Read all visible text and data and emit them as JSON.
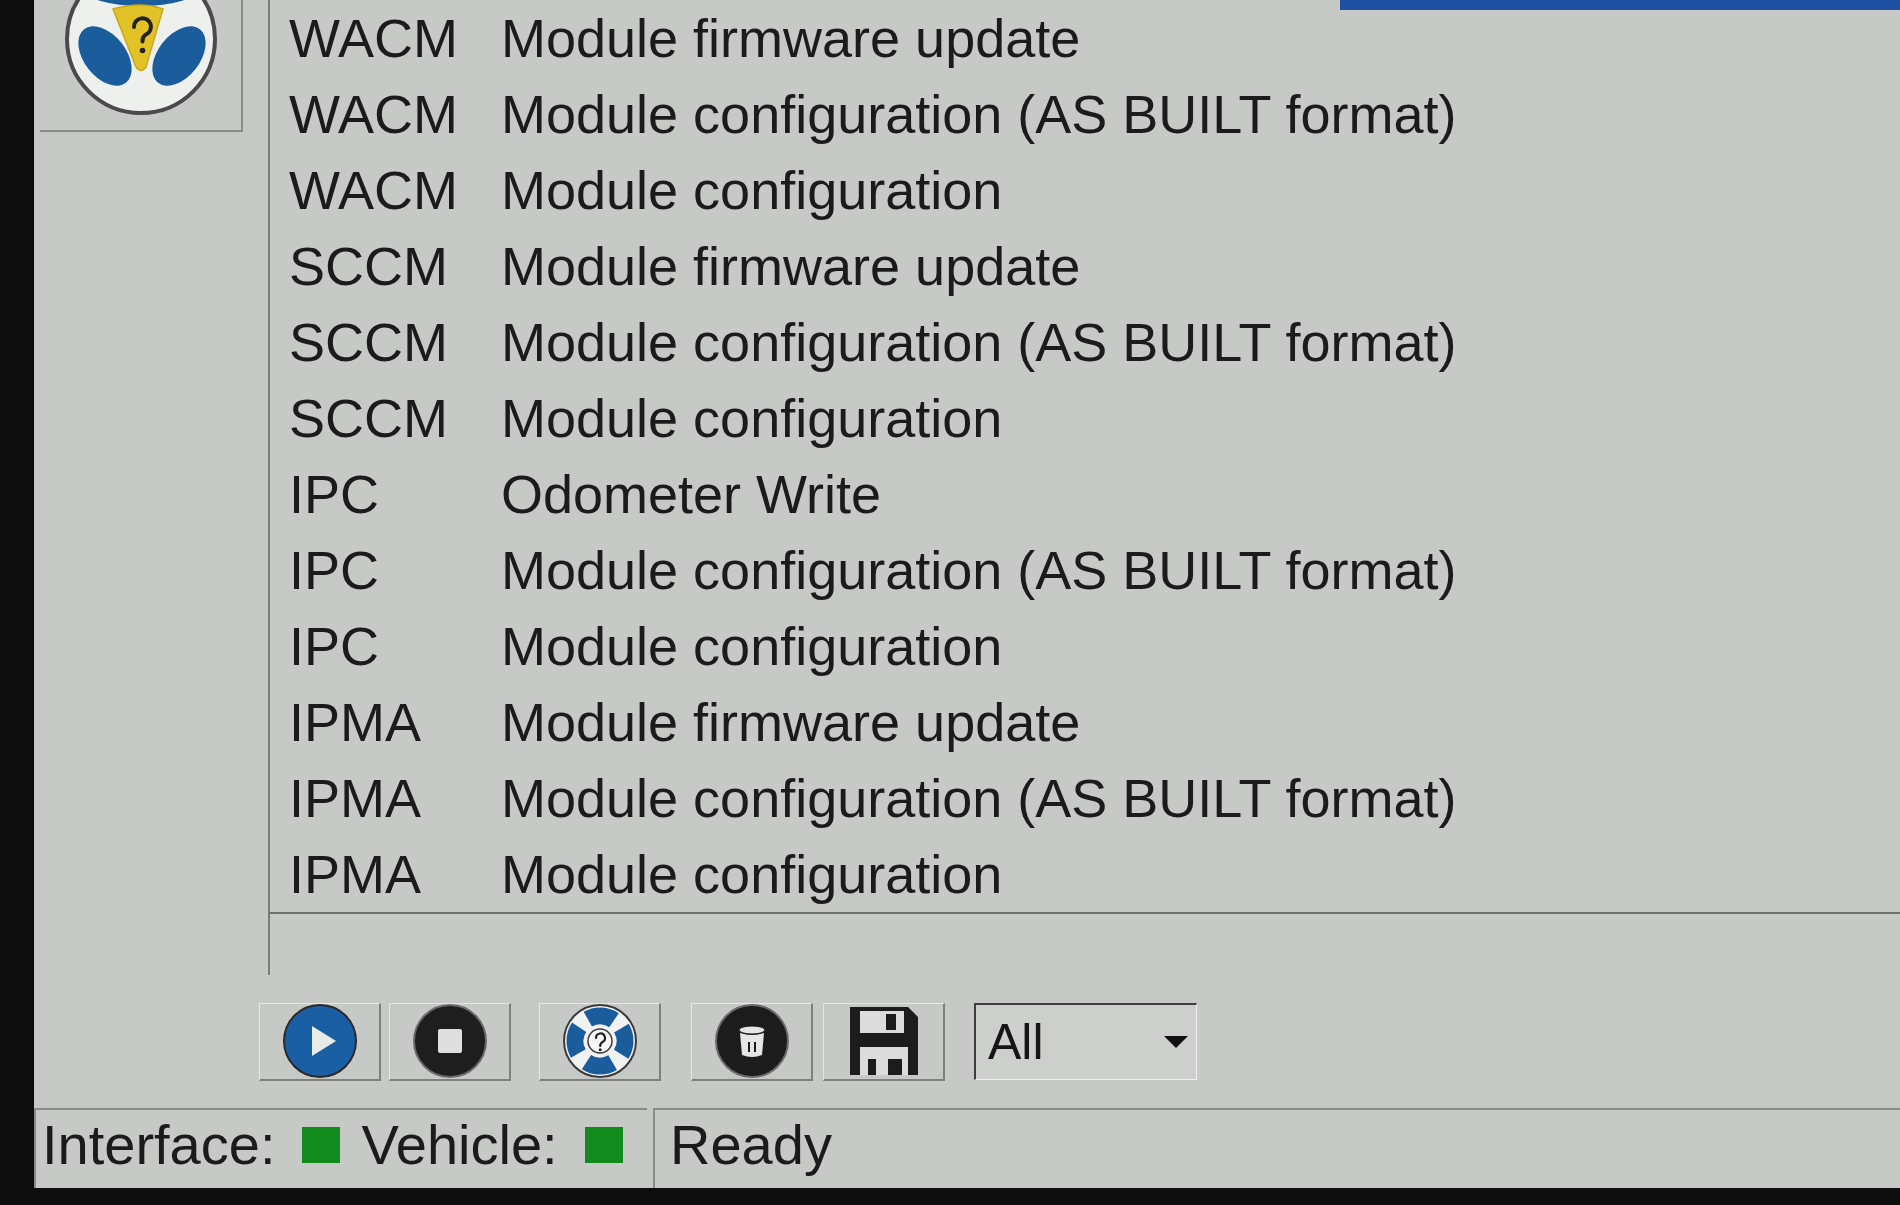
{
  "list": {
    "rows": [
      {
        "module": "WACM",
        "operation": "Module firmware update"
      },
      {
        "module": "WACM",
        "operation": "Module configuration (AS BUILT format)"
      },
      {
        "module": "WACM",
        "operation": "Module configuration"
      },
      {
        "module": "SCCM",
        "operation": "Module firmware update"
      },
      {
        "module": "SCCM",
        "operation": "Module configuration (AS BUILT format)"
      },
      {
        "module": "SCCM",
        "operation": "Module configuration"
      },
      {
        "module": "IPC",
        "operation": "Odometer Write"
      },
      {
        "module": "IPC",
        "operation": "Module configuration (AS BUILT format)"
      },
      {
        "module": "IPC",
        "operation": "Module configuration"
      },
      {
        "module": "IPMA",
        "operation": "Module firmware update"
      },
      {
        "module": "IPMA",
        "operation": "Module configuration (AS BUILT format)"
      },
      {
        "module": "IPMA",
        "operation": "Module configuration"
      }
    ]
  },
  "toolbar": {
    "buttons": [
      {
        "kind": "play"
      },
      {
        "kind": "stop"
      },
      {
        "kind": "help"
      },
      {
        "kind": "clear"
      },
      {
        "kind": "save"
      }
    ],
    "filter": {
      "value": "All"
    }
  },
  "status_bar": {
    "indicators": [
      {
        "label": "Interface:",
        "connected": true
      },
      {
        "label": "Vehicle:",
        "connected": true
      }
    ],
    "message": "Ready"
  }
}
